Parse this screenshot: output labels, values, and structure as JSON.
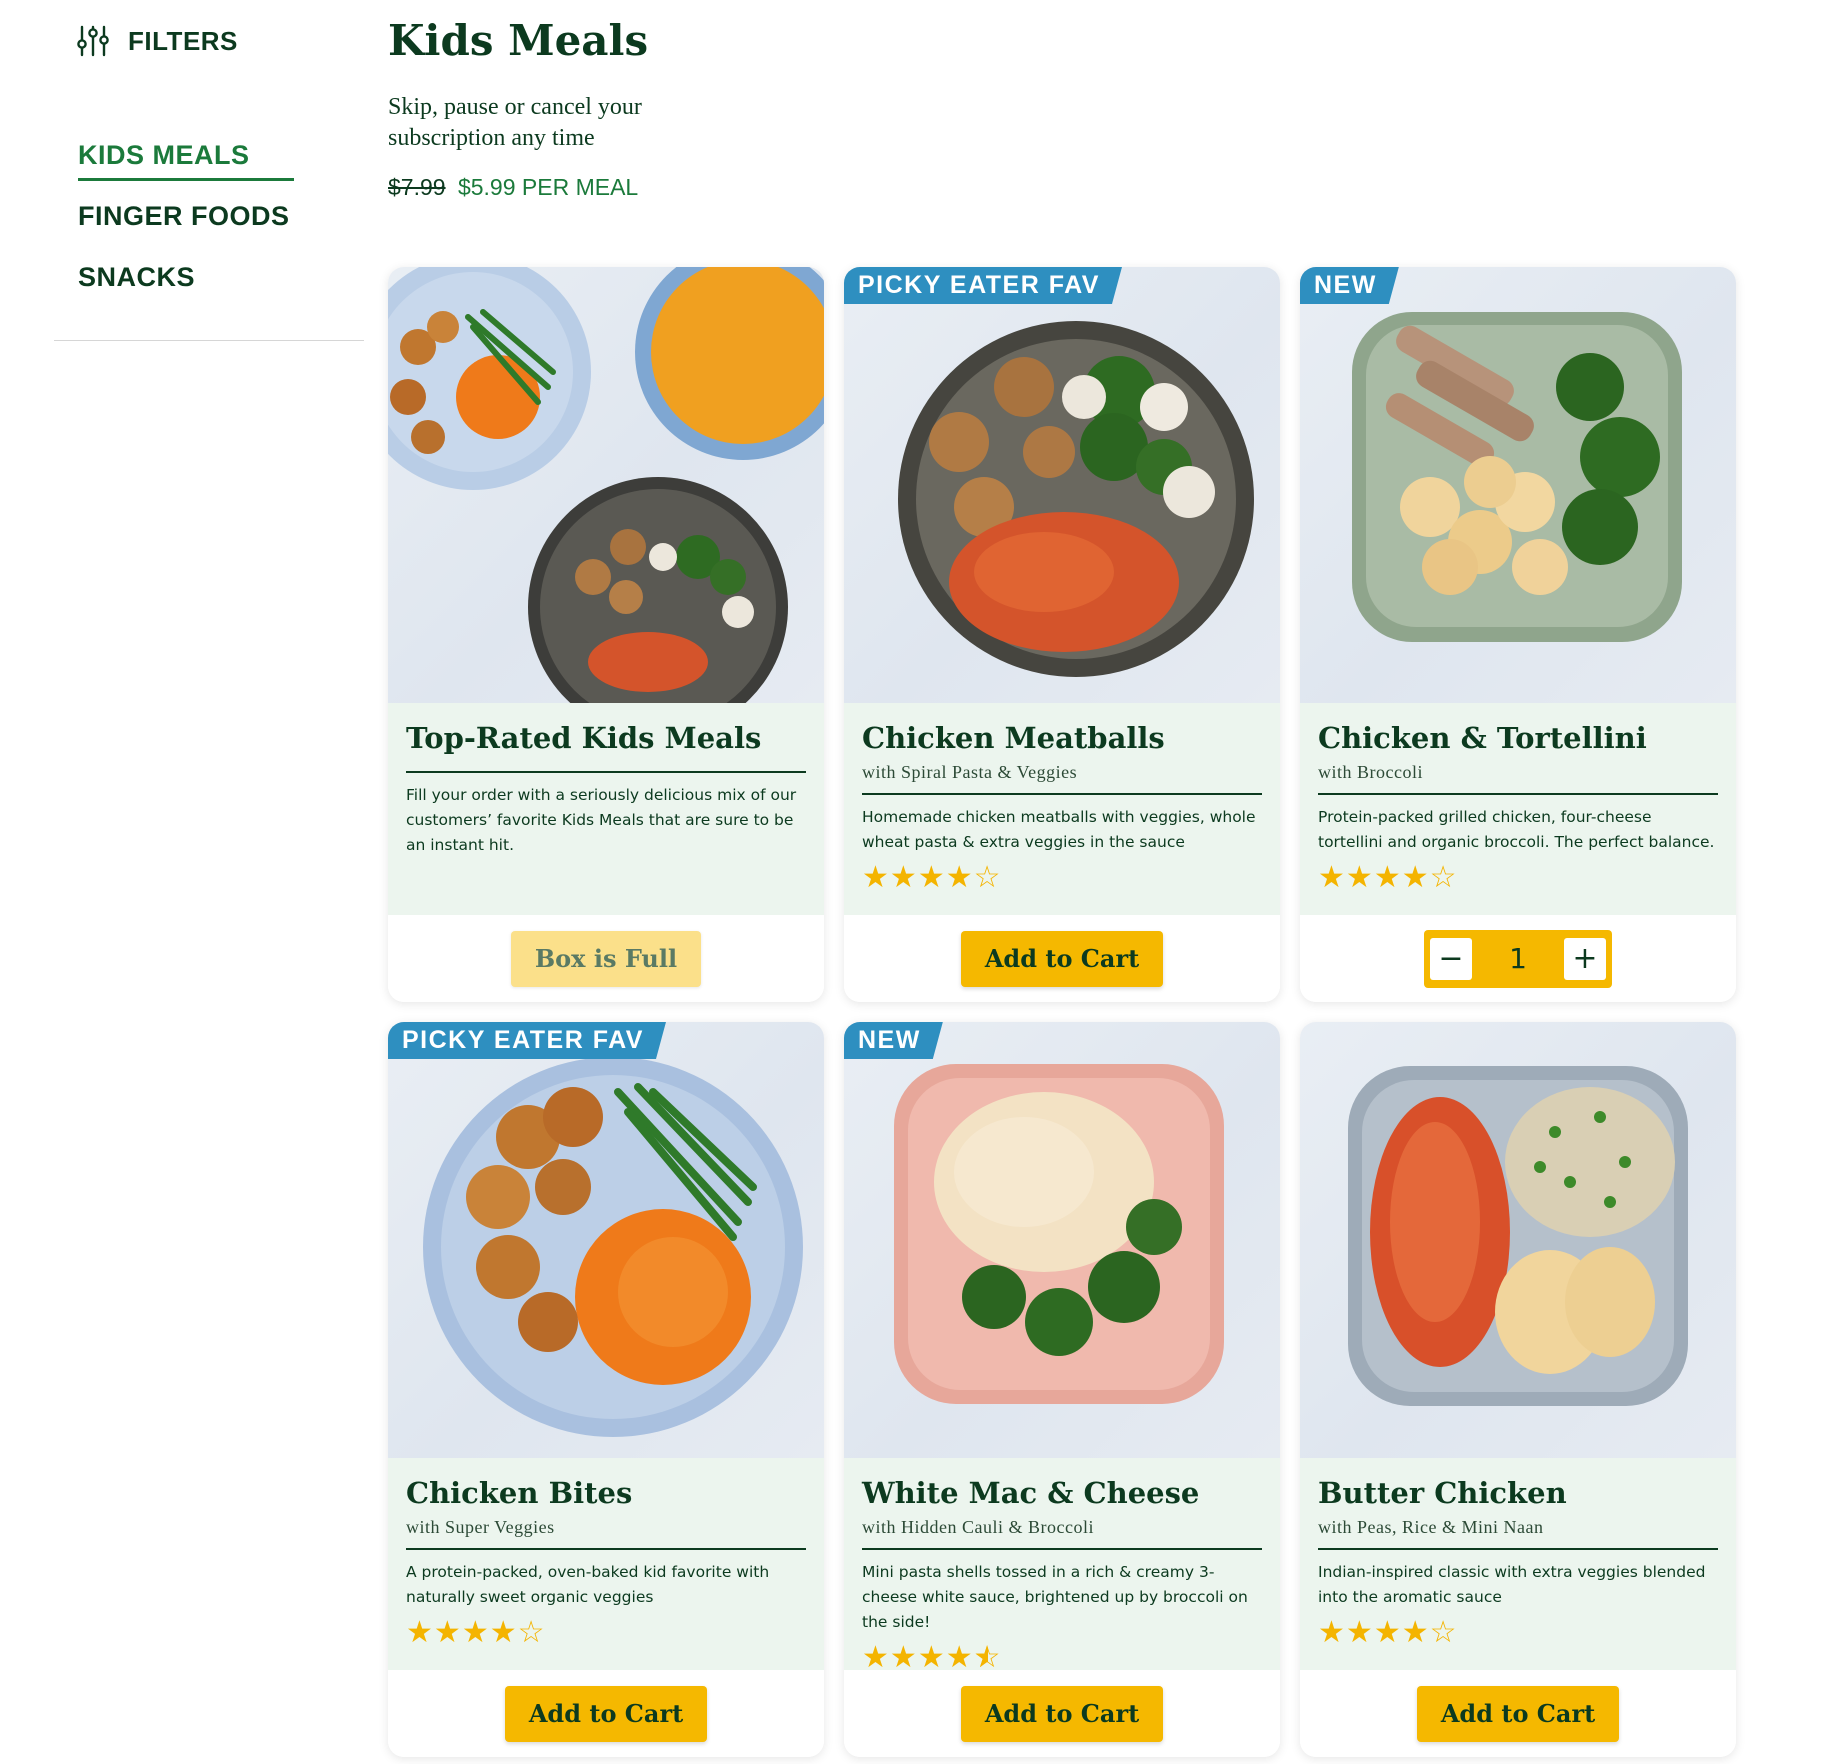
{
  "sidebar": {
    "filters_label": "FILTERS",
    "items": [
      {
        "label": "KIDS MEALS",
        "active": true
      },
      {
        "label": "FINGER FOODS",
        "active": false
      },
      {
        "label": "SNACKS",
        "active": false
      }
    ]
  },
  "header": {
    "title": "Kids Meals",
    "subtitle": "Skip, pause or cancel your subscription any time",
    "price_old": "$7.99",
    "price_new": "$5.99 PER MEAL"
  },
  "colors": {
    "brand_green": "#0c3a1f",
    "accent_green": "#1b7a3b",
    "button_yellow": "#f5b800",
    "badge_blue": "#2e8fc0",
    "card_body_bg": "#ecf5ee"
  },
  "cards": [
    {
      "badge": "",
      "title": "Top-Rated Kids Meals",
      "subtitle": "",
      "description": "Fill your order with a seriously delicious mix of our customers’ favorite Kids Meals that are sure to be an instant hit.",
      "rating": null,
      "button": "Box is Full",
      "button_disabled": true,
      "image": "three kids meal plates"
    },
    {
      "badge": "PICKY EATER FAV",
      "title": "Chicken Meatballs",
      "subtitle": "with Spiral Pasta & Veggies",
      "description": "Homemade chicken meatballs with veggies, whole wheat pasta & extra veggies in the sauce",
      "rating": 4,
      "button": "Add to Cart",
      "button_disabled": false,
      "image": "meatballs with spiral pasta and broccoli"
    },
    {
      "badge": "NEW",
      "title": "Chicken & Tortellini",
      "subtitle": "with Broccoli",
      "description": "Protein-packed grilled chicken, four-cheese tortellini and organic broccoli. The perfect balance.",
      "rating": 4,
      "quantity": "1",
      "image": "grilled chicken tortellini broccoli"
    },
    {
      "badge": "PICKY EATER FAV",
      "title": "Chicken Bites",
      "subtitle": "with Super Veggies",
      "description": "A protein-packed, oven-baked kid favorite with naturally sweet organic veggies",
      "rating": 4,
      "button": "Add to Cart",
      "button_disabled": false,
      "image": "chicken bites green beans sweet potato"
    },
    {
      "badge": "NEW",
      "title": "White Mac & Cheese",
      "subtitle": "with Hidden Cauli & Broccoli",
      "description": "Mini pasta shells tossed in a rich & creamy 3-cheese white sauce, brightened up by broccoli on the side!",
      "rating": 4.5,
      "button": "Add to Cart",
      "button_disabled": false,
      "image": "shell pasta mac and cheese broccoli"
    },
    {
      "badge": "",
      "title": "Butter Chicken",
      "subtitle": "with Peas, Rice & Mini Naan",
      "description": "Indian-inspired classic with extra veggies blended into the aromatic sauce",
      "rating": 4,
      "button": "Add to Cart",
      "button_disabled": false,
      "image": "butter chicken rice peas naan"
    }
  ]
}
